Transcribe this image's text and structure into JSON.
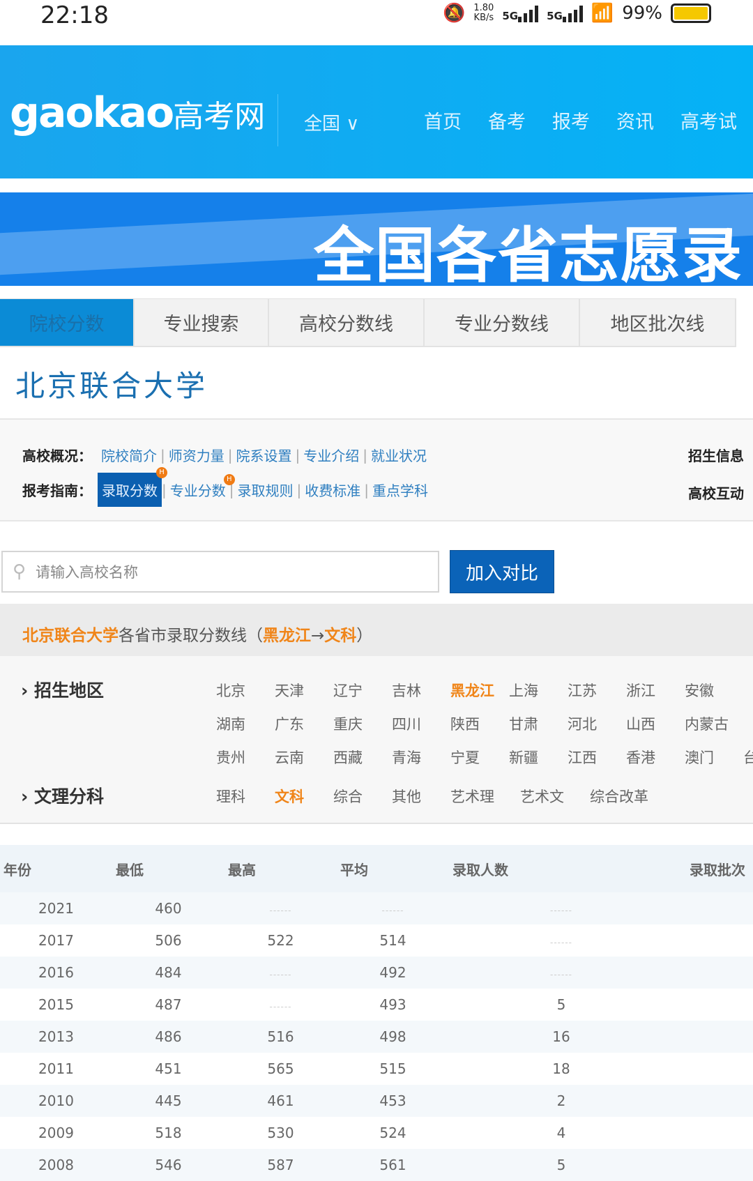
{
  "status": {
    "time": "22:18",
    "speed": "1.80",
    "speed_unit": "KB/s",
    "net1": "5G",
    "net2": "5G",
    "battery": "99%"
  },
  "header": {
    "logo": "gaokao",
    "logo_cn": "高考网",
    "region": "全国",
    "nav": [
      "首页",
      "备考",
      "报考",
      "资讯",
      "高考试"
    ]
  },
  "banner": {
    "text": "全国各省志愿录"
  },
  "tabs": [
    "院校分数",
    "专业搜索",
    "高校分数线",
    "专业分数线",
    "地区批次线"
  ],
  "school_name": "北京联合大学",
  "info": {
    "overview_label": "高校概况：",
    "overview_links": [
      "院校简介",
      "师资力量",
      "院系设置",
      "专业介绍",
      "就业状况"
    ],
    "guide_label": "报考指南：",
    "guide_links": [
      "录取分数",
      "专业分数",
      "录取规则",
      "收费标准",
      "重点学科"
    ],
    "hot": "H",
    "right1": "招生信息",
    "right2": "高校互动"
  },
  "search": {
    "placeholder": "请输入高校名称",
    "button": "加入对比"
  },
  "subhead": {
    "school": "北京联合大学",
    "mid": "各省市录取分数线（",
    "region": "黑龙江",
    "arrow": "→",
    "type": "文科",
    "end": "）"
  },
  "filters": {
    "region_label": "招生地区",
    "regions": [
      [
        "北京",
        "天津",
        "辽宁",
        "吉林",
        "黑龙江",
        "上海",
        "江苏",
        "浙江",
        "安徽"
      ],
      [
        "湖南",
        "广东",
        "重庆",
        "四川",
        "陕西",
        "甘肃",
        "河北",
        "山西",
        "内蒙古"
      ],
      [
        "贵州",
        "云南",
        "西藏",
        "青海",
        "宁夏",
        "新疆",
        "江西",
        "香港",
        "澳门",
        "台"
      ]
    ],
    "selected_region": "黑龙江",
    "type_label": "文理分科",
    "types": [
      "理科",
      "文科",
      "综合",
      "其他",
      "艺术理",
      "艺术文",
      "综合改革"
    ],
    "selected_type": "文科"
  },
  "table": {
    "headers": [
      "年份",
      "最低",
      "最高",
      "平均",
      "录取人数",
      "录取批次"
    ],
    "rows": [
      [
        "2021",
        "460",
        "------",
        "------",
        "------",
        ""
      ],
      [
        "2017",
        "506",
        "522",
        "514",
        "------",
        ""
      ],
      [
        "2016",
        "484",
        "------",
        "492",
        "------",
        ""
      ],
      [
        "2015",
        "487",
        "------",
        "493",
        "5",
        ""
      ],
      [
        "2013",
        "486",
        "516",
        "498",
        "16",
        ""
      ],
      [
        "2011",
        "451",
        "565",
        "515",
        "18",
        ""
      ],
      [
        "2010",
        "445",
        "461",
        "453",
        "2",
        ""
      ],
      [
        "2009",
        "518",
        "530",
        "524",
        "4",
        ""
      ],
      [
        "2008",
        "546",
        "587",
        "561",
        "5",
        ""
      ]
    ]
  }
}
